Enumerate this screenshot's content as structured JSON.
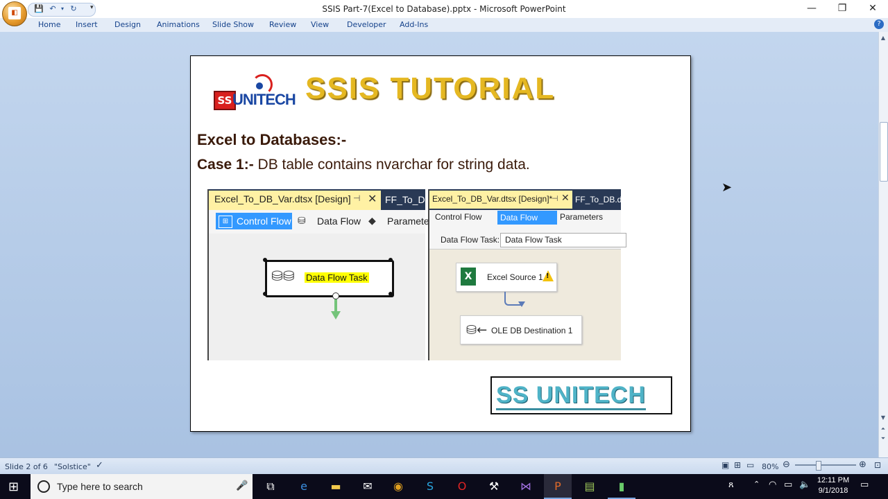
{
  "window": {
    "title": "SSIS Part-7(Excel to Database).pptx - Microsoft PowerPoint",
    "minimize": "—",
    "restore": "❐",
    "close": "✕"
  },
  "ribbon": {
    "tabs": [
      "Home",
      "Insert",
      "Design",
      "Animations",
      "Slide Show",
      "Review",
      "View",
      "Developer",
      "Add-Ins"
    ]
  },
  "slide": {
    "logo_ss": "SS",
    "logo_unitech": "UNITECH",
    "tutorial_title": "SSIS TUTORIAL",
    "heading": "Excel to Databases:-",
    "case_label": "Case 1:-",
    "case_text": " DB table contains nvarchar for string data.",
    "left_shot": {
      "active_tab": "Excel_To_DB_Var.dtsx [Design]",
      "pin": "⊣",
      "close": "✕",
      "other_tab": "FF_To_DB",
      "control_flow": "Control Flow",
      "data_flow": "Data Flow",
      "parameters": "Parameters",
      "task_label": "Data Flow Task"
    },
    "right_shot": {
      "active_tab": "Excel_To_DB_Var.dtsx [Design]*",
      "pin": "⊣",
      "close": "✕",
      "other_tab": "FF_To_DB.dtsx",
      "control_flow": "Control Flow",
      "data_flow": "Data Flow",
      "parameters": "Parameters",
      "dft_label": "Data Flow Task:",
      "dft_value": "Data Flow Task",
      "source_label": "Excel Source 1",
      "dest_label": "OLE DB Destination 1"
    },
    "brand": "SS UNITECH"
  },
  "statusbar": {
    "slide_info": "Slide 2 of 6",
    "theme": "\"Solstice\"",
    "zoom": "80%",
    "zoom_level": 0.5
  },
  "taskbar": {
    "search_placeholder": "Type here to search",
    "time": "12:11 PM",
    "date": "9/1/2018"
  }
}
